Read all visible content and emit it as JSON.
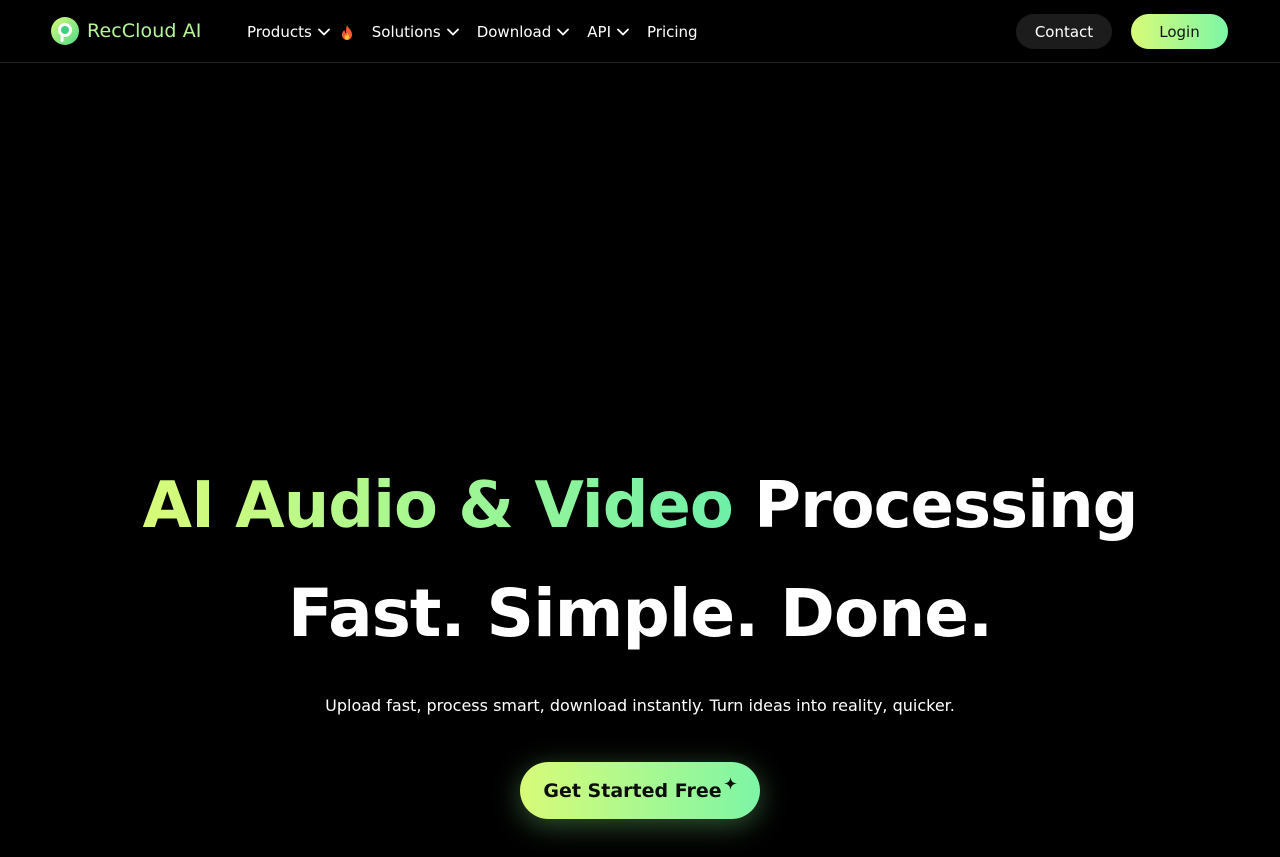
{
  "brand": {
    "name": "RecCloud AI",
    "logo_icon": "reccloud-logo-icon",
    "accent_start": "#d8fb78",
    "accent_end": "#7df6a6"
  },
  "nav": {
    "items": [
      {
        "label": "Products",
        "has_dropdown": true,
        "badge_icon": "fire-icon"
      },
      {
        "label": "Solutions",
        "has_dropdown": true
      },
      {
        "label": "Download",
        "has_dropdown": true
      },
      {
        "label": "API",
        "has_dropdown": true
      },
      {
        "label": "Pricing",
        "has_dropdown": false
      }
    ]
  },
  "header_actions": {
    "contact_label": "Contact",
    "login_label": "Login"
  },
  "hero": {
    "title_highlight": "AI Audio & Video",
    "title_rest": " Processing",
    "title_line2": "Fast. Simple. Done.",
    "subtitle": "Upload fast, process smart, download instantly. Turn ideas into reality, quicker.",
    "cta_label": "Get Started Free",
    "cta_icon": "sparkle-icon"
  }
}
